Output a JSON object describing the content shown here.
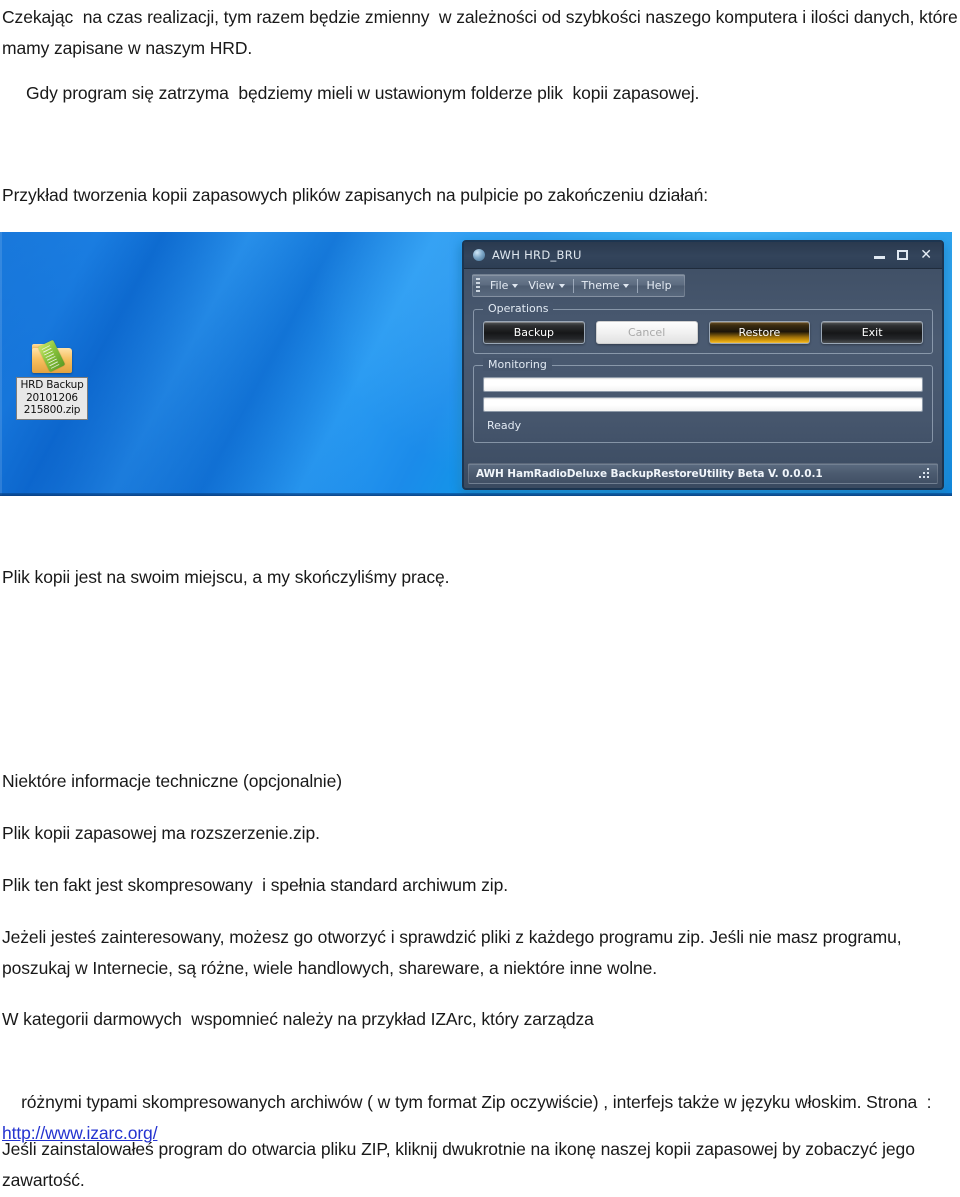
{
  "document": {
    "paragraphs": [
      {
        "id": "p1",
        "text": "Czekając  na czas realizacji, tym razem będzie zmienny  w zależności od szybkości naszego komputera i ilości danych, które mamy zapisane w naszym HRD."
      },
      {
        "id": "p2",
        "text": "Gdy program się zatrzyma  będziemy mieli w ustawionym folderze plik  kopii zapasowej."
      },
      {
        "id": "p3",
        "text": "Przykład tworzenia kopii zapasowych plików zapisanych na pulpicie po zakończeniu działań:"
      },
      {
        "id": "p4",
        "text": "Plik kopii jest na swoim miejscu, a my skończyliśmy pracę."
      },
      {
        "id": "p5",
        "text": "Niektóre informacje techniczne (opcjonalnie)"
      },
      {
        "id": "p6",
        "text": "Plik kopii zapasowej ma rozszerzenie.zip."
      },
      {
        "id": "p7",
        "text": "Plik ten fakt jest skompresowany  i spełnia standard archiwum zip."
      },
      {
        "id": "p8",
        "text": "Jeżeli jesteś zainteresowany, możesz go otworzyć i sprawdzić pliki z każdego programu zip. Jeśli nie masz programu, poszukaj w Internecie, są różne, wiele handlowych, shareware, a niektóre inne wolne."
      },
      {
        "id": "p9",
        "text": "W kategorii darmowych  wspomnieć należy na przykład IZArc, który zarządza"
      },
      {
        "id": "p10_a",
        "text": "różnymi typami skompresowanych archiwów ( w tym format Zip oczywiście) , interfejs także w języku włoskim. Strona  : "
      },
      {
        "id": "p10_link",
        "text": "http://www.izarc.org/"
      },
      {
        "id": "p11",
        "text": "Jeśli zainstalowałeś program do otwarcia pliku ZIP, kliknij dwukrotnie na ikonę naszej kopii zapasowej by zobaczyć jego zawartość."
      }
    ],
    "link_color": "#2433d0"
  },
  "screenshot": {
    "desktop": {
      "wallpaper_colors": [
        "#1d7fe0",
        "#2a9bf2",
        "#0e86dd"
      ],
      "icon": {
        "glyph": "zip-folder-icon",
        "label_line1": "HRD Backup",
        "label_line2": "20101206",
        "label_line3": "215800.zip"
      }
    },
    "app_window": {
      "title": "AWH HRD_BRU",
      "window_controls": {
        "minimize": "minimize-icon",
        "maximize": "maximize-icon",
        "close": "✕"
      },
      "menu": [
        {
          "label": "File",
          "has_caret": true
        },
        {
          "label": "View",
          "has_caret": true
        },
        {
          "label": "Theme",
          "has_caret": true
        },
        {
          "label": "Help",
          "has_caret": false
        }
      ],
      "operations": {
        "group_label": "Operations",
        "buttons": [
          {
            "label": "Backup",
            "style": "dark",
            "enabled": true
          },
          {
            "label": "Cancel",
            "style": "disabled",
            "enabled": false
          },
          {
            "label": "Restore",
            "style": "accent",
            "enabled": true
          },
          {
            "label": "Exit",
            "style": "dark",
            "enabled": true
          }
        ],
        "accent_color": "#e3a50c"
      },
      "monitoring": {
        "group_label": "Monitoring",
        "progress_bars": [
          {
            "value": 0
          },
          {
            "value": 0
          }
        ],
        "status": "Ready"
      },
      "statusbar": {
        "text": "AWH HamRadioDeluxe BackupRestoreUtility Beta V. 0.0.0.1",
        "grip": "resize-grip-icon"
      }
    }
  }
}
